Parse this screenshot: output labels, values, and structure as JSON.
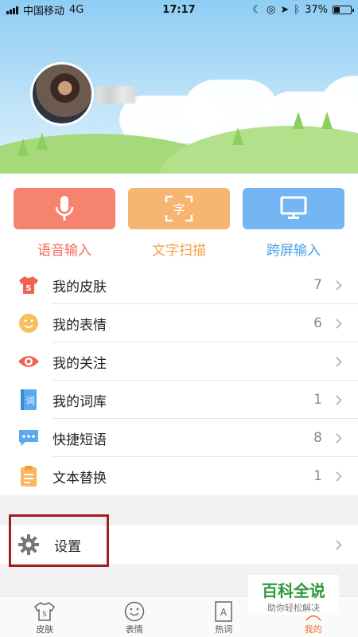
{
  "status_bar": {
    "carrier": "中国移动",
    "network": "4G",
    "time": "17:17",
    "battery": "37%",
    "battery_level": 0.37
  },
  "quick_actions": [
    {
      "label": "语音输入",
      "icon": "microphone-icon",
      "color": "#f6836e",
      "text_color": "#f26b5b"
    },
    {
      "label": "文字扫描",
      "icon": "scan-text-icon",
      "color": "#f7b572",
      "text_color": "#f2a24a",
      "glyph": "字"
    },
    {
      "label": "跨屏输入",
      "icon": "monitor-icon",
      "color": "#74b6f3",
      "text_color": "#4a9ee8"
    }
  ],
  "menu": [
    {
      "label": "我的皮肤",
      "count": "7",
      "icon": "skin-shirt-icon"
    },
    {
      "label": "我的表情",
      "count": "6",
      "icon": "smiley-icon"
    },
    {
      "label": "我的关注",
      "count": "",
      "icon": "eye-icon"
    },
    {
      "label": "我的词库",
      "count": "1",
      "icon": "dictionary-icon",
      "glyph": "词"
    },
    {
      "label": "快捷短语",
      "count": "8",
      "icon": "chat-bubble-icon"
    },
    {
      "label": "文本替换",
      "count": "1",
      "icon": "clipboard-icon"
    }
  ],
  "settings": {
    "label": "设置",
    "icon": "gear-icon"
  },
  "tabs": [
    {
      "label": "皮肤",
      "icon": "skin-shirt-icon"
    },
    {
      "label": "表情",
      "icon": "smiley-icon"
    },
    {
      "label": "热词",
      "icon": "hot-word-icon"
    },
    {
      "label": "我的",
      "icon": "profile-icon"
    }
  ],
  "watermark": {
    "line1": "百科全说",
    "line2": "助你轻松解决"
  }
}
